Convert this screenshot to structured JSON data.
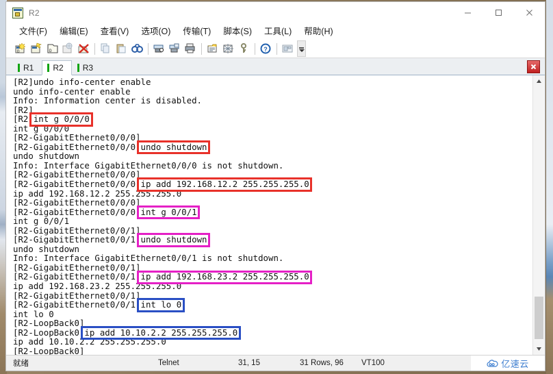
{
  "window": {
    "title": "R2",
    "icon": "terminal-app-icon",
    "controls": {
      "minimize": "—",
      "maximize": "□",
      "close": "✕"
    }
  },
  "menubar": {
    "items": [
      {
        "name": "file",
        "label": "文件(F)",
        "text": "文件",
        "key": "F"
      },
      {
        "name": "edit",
        "label": "编辑(E)",
        "text": "编辑",
        "key": "E"
      },
      {
        "name": "view",
        "label": "查看(V)",
        "text": "查看",
        "key": "V"
      },
      {
        "name": "options",
        "label": "选项(O)",
        "text": "选项",
        "key": "O"
      },
      {
        "name": "transfer",
        "label": "传输(T)",
        "text": "传输",
        "key": "T"
      },
      {
        "name": "script",
        "label": "脚本(S)",
        "text": "脚本",
        "key": "S"
      },
      {
        "name": "tools",
        "label": "工具(L)",
        "text": "工具",
        "key": "L"
      },
      {
        "name": "help",
        "label": "帮助(H)",
        "text": "帮助",
        "key": "H"
      }
    ]
  },
  "toolbar": {
    "buttons": [
      "new-session-icon",
      "connect-sftp-icon",
      "new-tab-icon",
      "clone-session-icon",
      "disconnect-icon",
      "copy-icon",
      "paste-icon",
      "find-icon",
      "log-session-icon",
      "print-preview-icon",
      "print-icon",
      "session-options-icon",
      "toggle-chat-icon",
      "key-icon",
      "help-icon",
      "tile-windows-icon"
    ],
    "overflow": "toolbar-overflow-icon"
  },
  "tabs": {
    "items": [
      {
        "label": "R1",
        "active": false
      },
      {
        "label": "R2",
        "active": true
      },
      {
        "label": "R3",
        "active": false
      }
    ],
    "close_label": "✕"
  },
  "terminal": {
    "lines": [
      "[R2]undo info-center enable",
      "undo info-center enable",
      "Info: Information center is disabled.",
      "[R2]",
      "[R2]int g 0/0/0",
      "int g 0/0/0",
      "[R2-GigabitEthernet0/0/0]",
      "[R2-GigabitEthernet0/0/0]undo shutdown",
      "undo shutdown",
      "Info: Interface GigabitEthernet0/0/0 is not shutdown.",
      "[R2-GigabitEthernet0/0/0]",
      "[R2-GigabitEthernet0/0/0]ip add 192.168.12.2 255.255.255.0",
      "ip add 192.168.12.2 255.255.255.0",
      "[R2-GigabitEthernet0/0/0]",
      "[R2-GigabitEthernet0/0/0]int g 0/0/1",
      "int g 0/0/1",
      "[R2-GigabitEthernet0/0/1]",
      "[R2-GigabitEthernet0/0/1]undo shutdown",
      "undo shutdown",
      "Info: Interface GigabitEthernet0/0/1 is not shutdown.",
      "[R2-GigabitEthernet0/0/1]",
      "[R2-GigabitEthernet0/0/1]ip add 192.168.23.2 255.255.255.0",
      "ip add 192.168.23.2 255.255.255.0",
      "[R2-GigabitEthernet0/0/1]",
      "[R2-GigabitEthernet0/0/1]int lo 0",
      "int lo 0",
      "[R2-LoopBack0]",
      "[R2-LoopBack0]ip add 10.10.2.2 255.255.255.0",
      "ip add 10.10.2.2 255.255.255.0",
      "[R2-LoopBack0]",
      "[R2-LoopBack0]"
    ],
    "annotations": [
      {
        "name": "highlight-int-g-0-0-0",
        "color": "#e8312a",
        "line": 4,
        "text": "int g 0/0/0"
      },
      {
        "name": "highlight-undo-shutdown-g0",
        "color": "#e8312a",
        "line": 7,
        "text": "undo shutdown"
      },
      {
        "name": "highlight-ip-add-192-168-12-2",
        "color": "#e8312a",
        "line": 11,
        "text": "ip add 192.168.12.2 255.255.255.0"
      },
      {
        "name": "highlight-int-g-0-0-1",
        "color": "#e520c6",
        "line": 14,
        "text": "int g 0/0/1"
      },
      {
        "name": "highlight-undo-shutdown-g1",
        "color": "#e520c6",
        "line": 17,
        "text": "undo shutdown"
      },
      {
        "name": "highlight-ip-add-192-168-23-2",
        "color": "#e520c6",
        "line": 21,
        "text": "ip add 192.168.23.2 255.255.255.0"
      },
      {
        "name": "highlight-int-lo-0",
        "color": "#2a4fc4",
        "line": 24,
        "text": "int lo 0"
      },
      {
        "name": "highlight-ip-add-10-10-2-2",
        "color": "#2a4fc4",
        "line": 27,
        "text": "ip add 10.10.2.2 255.255.255.0"
      }
    ]
  },
  "scrollbar": {
    "up": "▲",
    "down": "▼"
  },
  "statusbar": {
    "ready": "就绪",
    "protocol": "Telnet",
    "cursor": "31, 15",
    "rows": "31 Rows, 96",
    "emulation": "VT100",
    "watermark": "亿速云"
  }
}
